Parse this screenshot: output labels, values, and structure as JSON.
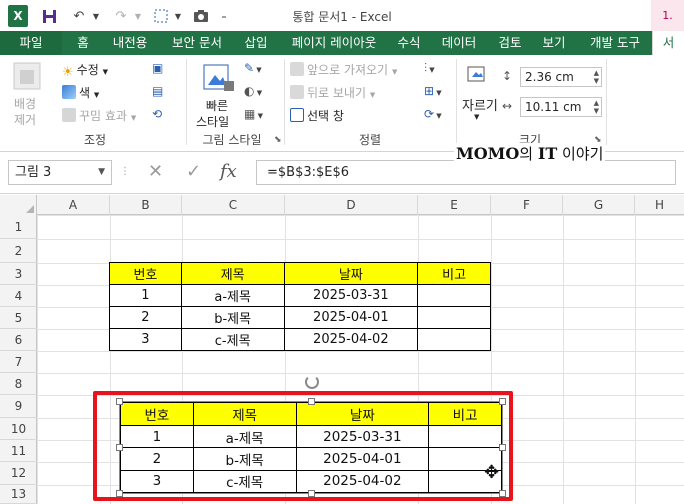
{
  "window": {
    "title": "통합 문서1 - Excel",
    "signin": "1."
  },
  "qat": {
    "excel_logo": "X"
  },
  "tabs": [
    {
      "label": "파일"
    },
    {
      "label": "홈"
    },
    {
      "label": "내전용"
    },
    {
      "label": "보안 문서"
    },
    {
      "label": "삽입"
    },
    {
      "label": "페이지 레이아웃"
    },
    {
      "label": "수식"
    },
    {
      "label": "데이터"
    },
    {
      "label": "검토"
    },
    {
      "label": "보기"
    },
    {
      "label": "개발 도구"
    },
    {
      "label": "서"
    }
  ],
  "ribbon": {
    "adjust": {
      "remove_bg_line1": "배경",
      "remove_bg_line2": "제거",
      "corrections": "수정",
      "color": "색",
      "artistic": "꾸밈 효과",
      "label": "조정"
    },
    "styles": {
      "quick_line1": "빠른",
      "quick_line2": "스타일",
      "label": "그림 스타일"
    },
    "arrange": {
      "bring_forward": "앞으로 가져오기",
      "send_backward": "뒤로 보내기",
      "selection_pane": "선택 창",
      "label": "정렬"
    },
    "size": {
      "crop": "자르기",
      "height": "2.36 cm",
      "width": "10.11 cm",
      "label": "크기"
    }
  },
  "watermark": {
    "brand": "MOMO",
    "mid": "의 ",
    "it": "IT",
    "tail": " 이야기"
  },
  "formula_bar": {
    "name_box": "그림 3",
    "formula": "=$B$3:$E$6",
    "fx": "fx"
  },
  "grid": {
    "columns": [
      "A",
      "B",
      "C",
      "D",
      "E",
      "F",
      "G",
      "H"
    ],
    "rows": [
      "1",
      "2",
      "3",
      "4",
      "5",
      "6",
      "7",
      "8",
      "9",
      "10",
      "11",
      "12",
      "13"
    ]
  },
  "table": {
    "headers": [
      "번호",
      "제목",
      "날짜",
      "비고"
    ],
    "rows": [
      [
        "1",
        "a-제목",
        "2025-03-31",
        ""
      ],
      [
        "2",
        "b-제목",
        "2025-04-01",
        ""
      ],
      [
        "3",
        "c-제목",
        "2025-04-02",
        ""
      ]
    ]
  },
  "picture_table": {
    "headers": [
      "번호",
      "제목",
      "날짜",
      "비고"
    ],
    "rows": [
      [
        "1",
        "a-제목",
        "2025-03-31",
        ""
      ],
      [
        "2",
        "b-제목",
        "2025-04-01",
        ""
      ],
      [
        "3",
        "c-제목",
        "2025-04-02",
        ""
      ]
    ]
  },
  "colors": {
    "excel_green": "#217346",
    "header_fill": "#ffff00",
    "highlight_red": "#e8141b"
  }
}
